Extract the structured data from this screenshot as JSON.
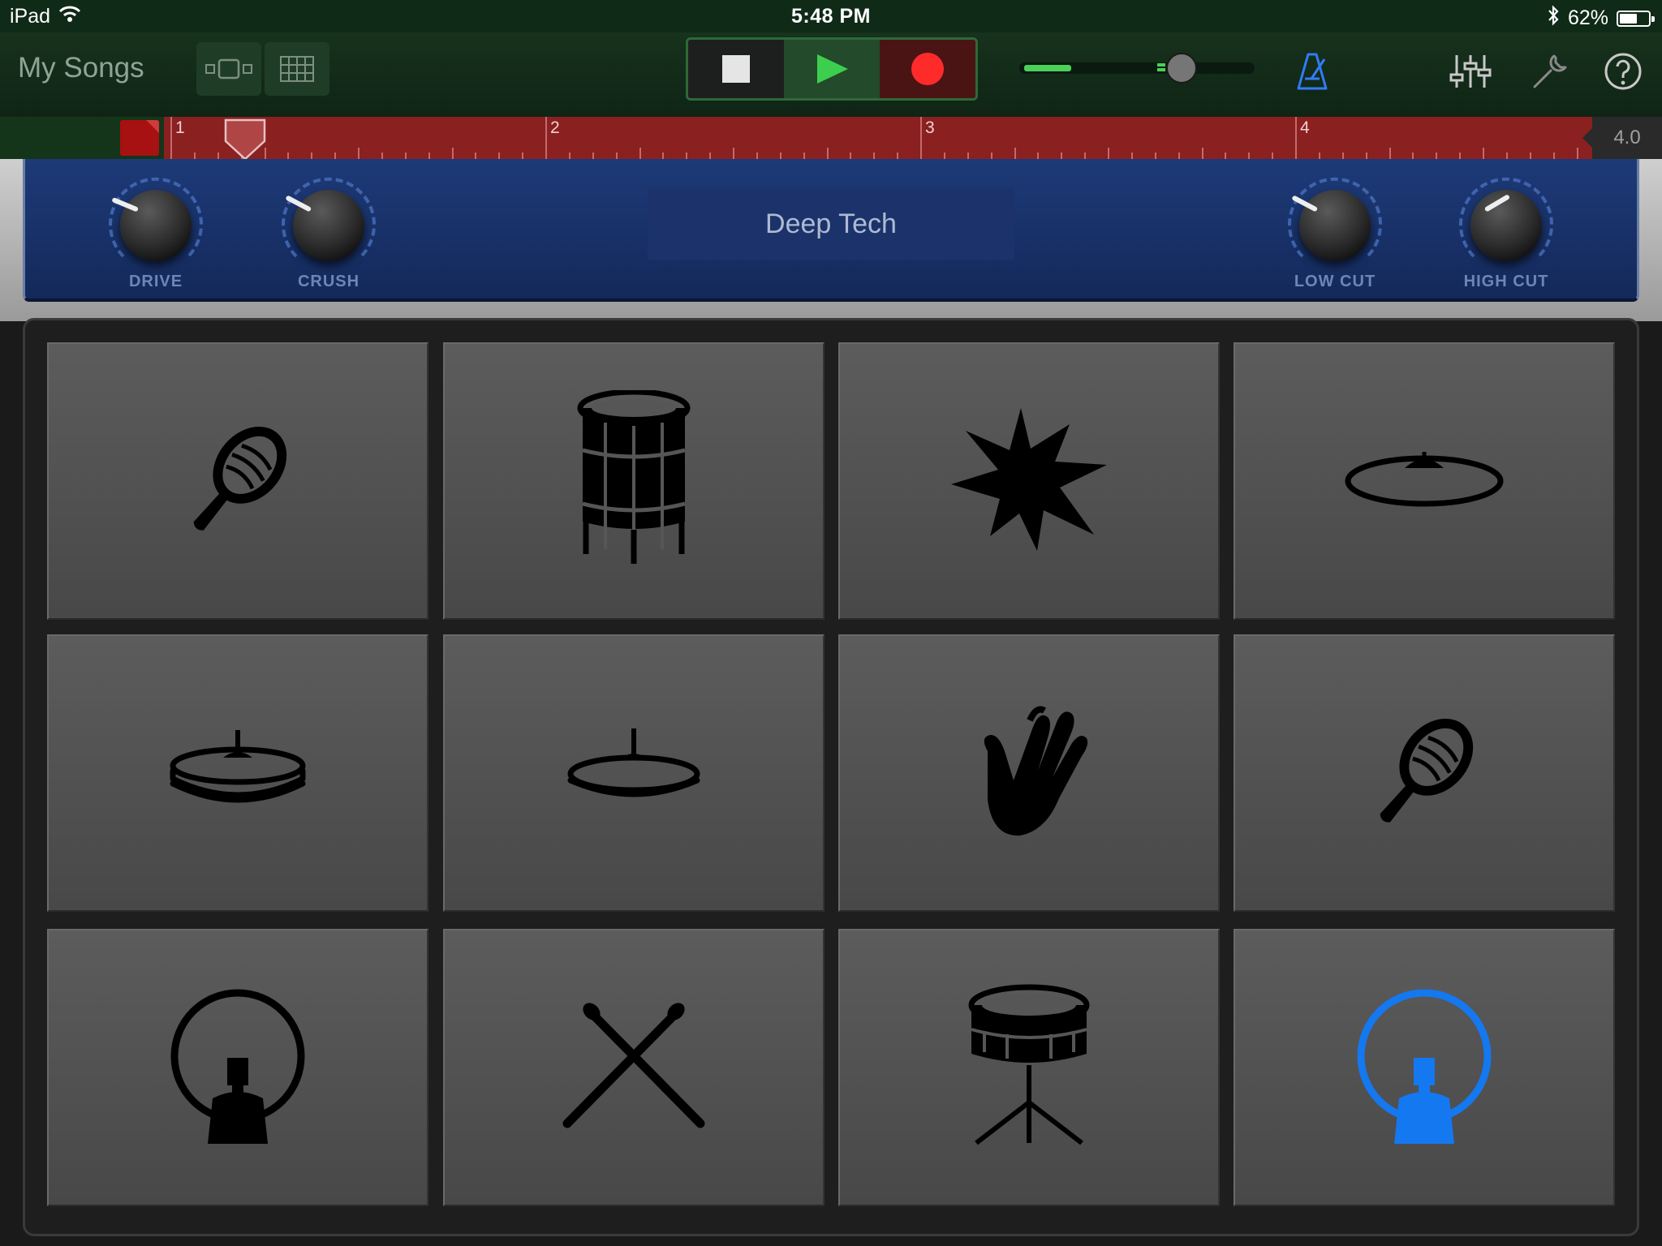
{
  "status_bar": {
    "device": "iPad",
    "time": "5:48 PM",
    "battery_text": "62%",
    "battery_level": 0.62,
    "icons": [
      "wifi-icon",
      "bluetooth-icon",
      "battery-icon"
    ]
  },
  "toolbar": {
    "my_songs_label": "My Songs",
    "view_buttons": [
      "tracks-view-icon",
      "grid-view-icon"
    ],
    "transport": [
      "stop-icon",
      "play-icon",
      "record-icon"
    ],
    "master_volume": 0.69,
    "level_meter": 0.21,
    "tools": [
      "metronome-icon",
      "mixer-icon",
      "settings-wrench-icon",
      "help-icon"
    ],
    "colors": {
      "metronome": "#2f7cf6",
      "play": "#3ccf4e",
      "record": "#ff2b2b"
    }
  },
  "ruler": {
    "bars": [
      "1",
      "2",
      "3",
      "4"
    ],
    "end_label": "4.0",
    "playhead_position": 1.2,
    "colors": {
      "ruler": "#8a2020",
      "cycle": "#a71111"
    }
  },
  "effects": {
    "patch_name": "Deep Tech",
    "knobs": [
      {
        "label": "DRIVE",
        "value": 0.25
      },
      {
        "label": "CRUSH",
        "value": 0.27
      },
      {
        "label": "LOW CUT",
        "value": 0.27
      },
      {
        "label": "HIGH CUT",
        "value": 0.72
      }
    ]
  },
  "pads": [
    {
      "icon": "shaker-icon",
      "active": false
    },
    {
      "icon": "tom-drum-icon",
      "active": false
    },
    {
      "icon": "burst-fx-icon",
      "active": false
    },
    {
      "icon": "ride-cymbal-icon",
      "active": false
    },
    {
      "icon": "hihat-closed-icon",
      "active": false
    },
    {
      "icon": "hihat-open-icon",
      "active": false
    },
    {
      "icon": "hand-clap-icon",
      "active": false
    },
    {
      "icon": "shaker-icon",
      "active": false
    },
    {
      "icon": "kick-drum-icon",
      "active": false
    },
    {
      "icon": "crossed-sticks-icon",
      "active": false
    },
    {
      "icon": "snare-drum-icon",
      "active": false
    },
    {
      "icon": "kick-drum-icon",
      "active": true
    }
  ],
  "pad_colors": {
    "icon": "#000000",
    "active_icon": "#1478f0"
  }
}
